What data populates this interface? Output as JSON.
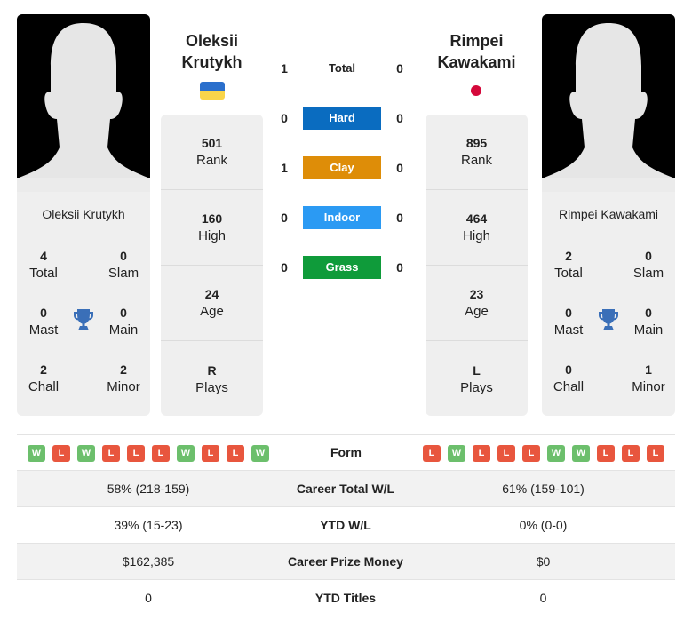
{
  "player1": {
    "name_line1": "Oleksii",
    "name_line2": "Krutykh",
    "full_name": "Oleksii Krutykh",
    "flag": "ukraine-flag",
    "flag_colors": [
      "#2a6fcc",
      "#f9d54a"
    ],
    "stats": [
      {
        "value": "501",
        "label": "Rank"
      },
      {
        "value": "160",
        "label": "High"
      },
      {
        "value": "24",
        "label": "Age"
      },
      {
        "value": "R",
        "label": "Plays"
      }
    ],
    "titles": {
      "total": {
        "value": "4",
        "label": "Total"
      },
      "slam": {
        "value": "0",
        "label": "Slam"
      },
      "mast": {
        "value": "0",
        "label": "Mast"
      },
      "main": {
        "value": "0",
        "label": "Main"
      },
      "chall": {
        "value": "2",
        "label": "Chall"
      },
      "minor": {
        "value": "2",
        "label": "Minor"
      }
    },
    "form": [
      "W",
      "L",
      "W",
      "L",
      "L",
      "L",
      "W",
      "L",
      "L",
      "W"
    ]
  },
  "player2": {
    "name_line1": "Rimpei",
    "name_line2": "Kawakami",
    "full_name": "Rimpei Kawakami",
    "flag": "japan-flag",
    "flag_colors": [
      "#d4083a"
    ],
    "stats": [
      {
        "value": "895",
        "label": "Rank"
      },
      {
        "value": "464",
        "label": "High"
      },
      {
        "value": "23",
        "label": "Age"
      },
      {
        "value": "L",
        "label": "Plays"
      }
    ],
    "titles": {
      "total": {
        "value": "2",
        "label": "Total"
      },
      "slam": {
        "value": "0",
        "label": "Slam"
      },
      "mast": {
        "value": "0",
        "label": "Mast"
      },
      "main": {
        "value": "0",
        "label": "Main"
      },
      "chall": {
        "value": "0",
        "label": "Chall"
      },
      "minor": {
        "value": "1",
        "label": "Minor"
      }
    },
    "form": [
      "L",
      "W",
      "L",
      "L",
      "L",
      "W",
      "W",
      "L",
      "L",
      "L"
    ]
  },
  "h2h": [
    {
      "label": "Total",
      "p1": "1",
      "p2": "0",
      "color": null
    },
    {
      "label": "Hard",
      "p1": "0",
      "p2": "0",
      "color": "#0a6cc0"
    },
    {
      "label": "Clay",
      "p1": "1",
      "p2": "0",
      "color": "#de8d08"
    },
    {
      "label": "Indoor",
      "p1": "0",
      "p2": "0",
      "color": "#2b9af3"
    },
    {
      "label": "Grass",
      "p1": "0",
      "p2": "0",
      "color": "#0f9b3a"
    }
  ],
  "form_label": "Form",
  "comparison": [
    {
      "label": "Career Total W/L",
      "p1": "58% (218-159)",
      "p2": "61% (159-101)"
    },
    {
      "label": "YTD W/L",
      "p1": "39% (15-23)",
      "p2": "0% (0-0)"
    },
    {
      "label": "Career Prize Money",
      "p1": "$162,385",
      "p2": "$0"
    },
    {
      "label": "YTD Titles",
      "p1": "0",
      "p2": "0"
    }
  ],
  "icons": {
    "trophy": "trophy-icon",
    "silhouette": "player-silhouette"
  }
}
